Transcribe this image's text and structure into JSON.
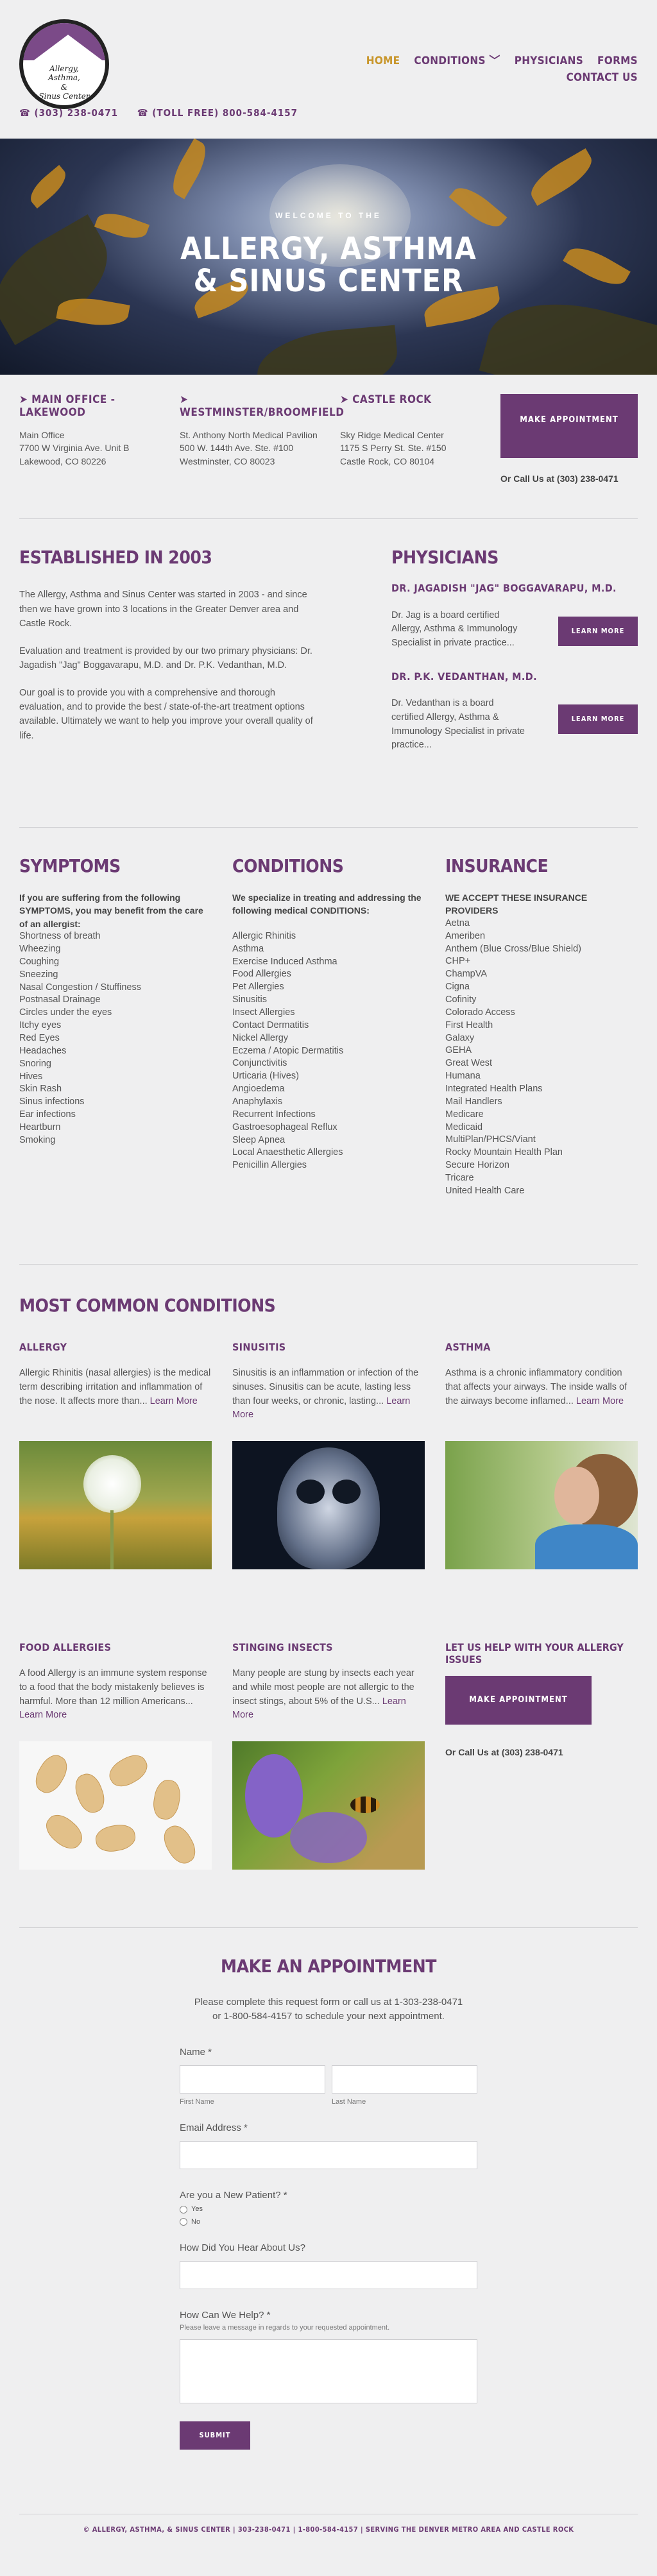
{
  "header": {
    "logo_text": [
      "Allergy,",
      "Asthma,",
      "&",
      "Sinus Center"
    ],
    "phone": "☎ (303) 238-0471",
    "toll_free": "☎ (TOLL FREE) 800-584-4157",
    "nav": {
      "home": "HOME",
      "conditions": "CONDITIONS ﹀",
      "physicians": "PHYSICIANS",
      "forms": "FORMS",
      "contact": "CONTACT US"
    }
  },
  "hero": {
    "welcome": "WELCOME TO THE",
    "title_line1": "ALLERGY, ASTHMA",
    "title_line2": "& SINUS CENTER"
  },
  "locations": [
    {
      "title": "➤ MAIN OFFICE - LAKEWOOD",
      "lines": [
        "Main Office",
        "7700 W Virginia Ave. Unit B",
        "Lakewood, CO 80226"
      ]
    },
    {
      "title": "➤ WESTMINSTER/BROOMFIELD",
      "lines": [
        "St. Anthony North Medical Pavilion",
        "500 W. 144th Ave. Ste. #100",
        "Westminster, CO 80023"
      ]
    },
    {
      "title": "➤ CASTLE ROCK",
      "lines": [
        "Sky Ridge Medical Center",
        "1175 S Perry St. Ste. #150",
        "Castle Rock, CO 80104"
      ]
    }
  ],
  "cta": {
    "make_appointment": "MAKE APPOINTMENT",
    "call": "Or Call Us at (303) 238-0471"
  },
  "established": {
    "title": "ESTABLISHED IN 2003",
    "paragraphs": [
      "The Allergy, Asthma and Sinus Center was started in 2003 - and since then we have grown into 3 locations in the Greater Denver area and Castle Rock.",
      "Evaluation and treatment is provided by our two primary physicians: Dr. Jagadish \"Jag\" Boggavarapu, M.D. and Dr. P.K. Vedanthan, M.D.",
      "Our goal is to provide you with a comprehensive and thorough evaluation, and to provide the best / state-of-the-art treatment options available.  Ultimately we want to help you improve your overall quality of life."
    ]
  },
  "physicians": {
    "title": "PHYSICIANS",
    "items": [
      {
        "name": "DR. JAGADISH \"JAG\" BOGGAVARAPU, M.D.",
        "text": "Dr. Jag is a board certified Allergy, Asthma & Immunology Specialist in private practice...",
        "button": "LEARN MORE"
      },
      {
        "name": "DR. P.K. VEDANTHAN, M.D.",
        "text": "Dr. Vedanthan is a board certified Allergy, Asthma & Immunology Specialist in private practice...",
        "button": "LEARN MORE"
      }
    ]
  },
  "symptoms": {
    "title": "SYMPTOMS",
    "intro": "If you are suffering from the following SYMPTOMS, you may benefit from the care of an allergist:",
    "items": [
      "Shortness of breath",
      "Wheezing",
      "Coughing",
      "Sneezing",
      "Nasal Congestion / Stuffiness",
      "Postnasal Drainage",
      "Circles under the eyes",
      "Itchy eyes",
      "Red Eyes",
      "Headaches",
      "Snoring",
      "Hives",
      "Skin Rash",
      "Sinus infections",
      "Ear infections",
      "Heartburn",
      "Smoking"
    ]
  },
  "conditions": {
    "title": "CONDITIONS",
    "intro": "We specialize in treating and addressing the following medical CONDITIONS:",
    "items": [
      "Allergic Rhinitis",
      "Asthma",
      "Exercise Induced Asthma",
      "Food Allergies",
      "Pet Allergies",
      "Sinusitis",
      "Insect Allergies",
      "Contact Dermatitis",
      "Nickel Allergy",
      "Eczema / Atopic Dermatitis",
      "Conjunctivitis",
      "Urticaria (Hives)",
      "Angioedema",
      "Anaphylaxis",
      "Recurrent Infections",
      "Gastroesophageal Reflux",
      "Sleep Apnea",
      "Local Anaesthetic Allergies",
      "Penicillin Allergies"
    ]
  },
  "insurance": {
    "title": "INSURANCE",
    "intro": "WE ACCEPT THESE INSURANCE PROVIDERS",
    "items": [
      "Aetna",
      "Ameriben",
      "Anthem (Blue Cross/Blue Shield)",
      "CHP+",
      "ChampVA",
      "Cigna",
      "Cofinity",
      "Colorado Access",
      "First Health",
      "Galaxy",
      "GEHA",
      "Great West",
      "Humana",
      "Integrated Health Plans",
      "Mail Handlers",
      "Medicare",
      "Medicaid",
      "MultiPlan/PHCS/Viant",
      "Rocky Mountain Health Plan",
      "Secure Horizon",
      "Tricare",
      "United Health Care"
    ]
  },
  "common": {
    "title": "MOST COMMON CONDITIONS",
    "learn_more": "Learn More",
    "cards": [
      {
        "title": "ALLERGY",
        "text": "Allergic Rhinitis (nasal allergies) is the medical term describing irritation and inflammation of the nose. It affects more than...",
        "image": "dandelion-photo"
      },
      {
        "title": "SINUSITIS",
        "text": "Sinusitis is an inflammation or infection of the sinuses. Sinusitis can be acute, lasting less than four weeks, or chronic, lasting...",
        "image": "skull-xray-photo"
      },
      {
        "title": "ASTHMA",
        "text": "Asthma is a chronic inflammatory condition that affects your airways. The inside walls of the airways become inflamed...",
        "image": "inhaler-woman-photo"
      },
      {
        "title": "FOOD ALLERGIES",
        "text": "A food Allergy is an immune system response to a food that the body mistakenly believes is harmful. More than 12 million Americans...",
        "image": "peanuts-photo"
      },
      {
        "title": "STINGING INSECTS",
        "text": "Many people are stung by insects each year and while most people are not allergic to the insect stings, about 5% of the U.S...",
        "image": "bee-flower-photo"
      }
    ],
    "help_title": "LET US HELP WITH YOUR ALLERGY ISSUES",
    "help_button": "MAKE APPOINTMENT",
    "help_call": "Or Call Us at (303) 238-0471"
  },
  "appointment": {
    "title": "MAKE AN APPOINTMENT",
    "desc_line1": "Please complete this request form or call us at 1-303-238-0471",
    "desc_line2": "or 1-800-584-4157 to schedule your next appointment.",
    "name_label": "Name *",
    "first_name": "First Name",
    "last_name": "Last Name",
    "email_label": "Email Address *",
    "new_patient_label": "Are you a New Patient? *",
    "yes": "Yes",
    "no": "No",
    "hear_label": "How Did You Hear About Us?",
    "help_label": "How Can We Help? *",
    "help_hint": "Please leave a message in regards to your requested appointment.",
    "submit": "SUBMIT"
  },
  "footer": {
    "text": "© ALLERGY, ASTHMA, & SINUS CENTER  |  303-238-0471  |  1-800-584-4157  |  SERVING THE DENVER METRO AREA AND CASTLE ROCK"
  },
  "colors": {
    "brand": "#6b3a73",
    "nav_active": "#c8962b",
    "background": "#efeff0"
  }
}
